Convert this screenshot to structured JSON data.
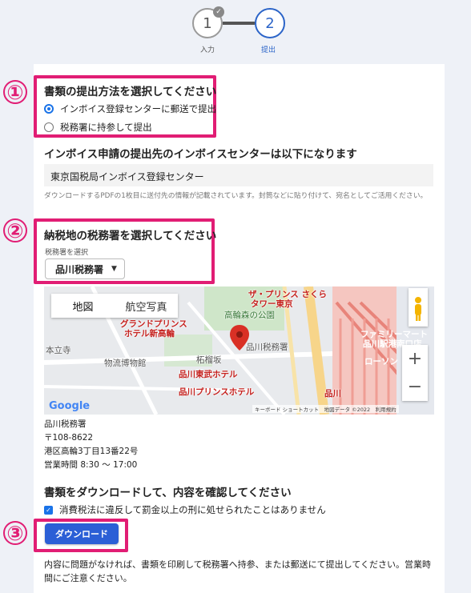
{
  "stepper": {
    "step1": {
      "number": "1",
      "label": "入力",
      "done_mark": "✓"
    },
    "step2": {
      "number": "2",
      "label": "提出"
    }
  },
  "annotations": {
    "n1": "①",
    "n2": "②",
    "n3": "③",
    "color": "#e11d74"
  },
  "section1": {
    "title": "書類の提出方法を選択してください",
    "options": [
      {
        "label": "インボイス登録センターに郵送で提出",
        "selected": true
      },
      {
        "label": "税務署に持参して提出",
        "selected": false
      }
    ]
  },
  "invoice": {
    "heading": "インボイス申請の提出先のインボイスセンターは以下になります",
    "center_name": "東京国税局インボイス登録センター",
    "note": "ダウンロードするPDFの1枚目に送付先の情報が記載されています。封筒などに貼り付けて、宛名としてご活用ください。"
  },
  "section2": {
    "title": "納税地の税務署を選択してください",
    "field_label": "税務署を選択",
    "selected_office": "品川税務署",
    "caret": "▼"
  },
  "map": {
    "tabs": [
      "地図",
      "航空写真"
    ],
    "labels": {
      "grand_prince": "グランドプリンス",
      "grand_prince2": "ホテル新高輪",
      "hotel_park": "高輪森の公園",
      "office": "品川税務署",
      "tower": "ザ・プリンス さくら",
      "tower2": "タワー東京",
      "motohongaku": "本立寺",
      "museum": "物流博物館",
      "tozai": "柘榴坂",
      "tobu": "品川東武ホテル",
      "prince": "品川プリンスホテル",
      "familymart": "ファミリーマート",
      "familymart2": "品川駅港南口店",
      "lawson": "ローソン",
      "shinagawa": "品川"
    },
    "footer": "キーボード ショートカット　地図データ ©2022　利用規約",
    "google": "Google",
    "zoom_in": "+",
    "zoom_out": "−"
  },
  "address": {
    "name": "品川税務署",
    "zip": "〒108-8622",
    "street": "港区高輪3丁目13番22号",
    "hours": "営業時間 8:30 ～ 17:00"
  },
  "section3": {
    "title": "書類をダウンロードして、内容を確認してください",
    "checkbox_label": "消費税法に違反して罰金以上の刑に処せられたことはありません",
    "check_mark": "✓",
    "download_label": "ダウンロード",
    "bottom_note": "内容に問題がなければ、書類を印刷して税務署へ持参、または郵送にて提出してください。営業時間にご注意ください。"
  },
  "colors": {
    "accent": "#2b64c8",
    "button": "#2b5fd6",
    "highlight": "#e11d74"
  }
}
